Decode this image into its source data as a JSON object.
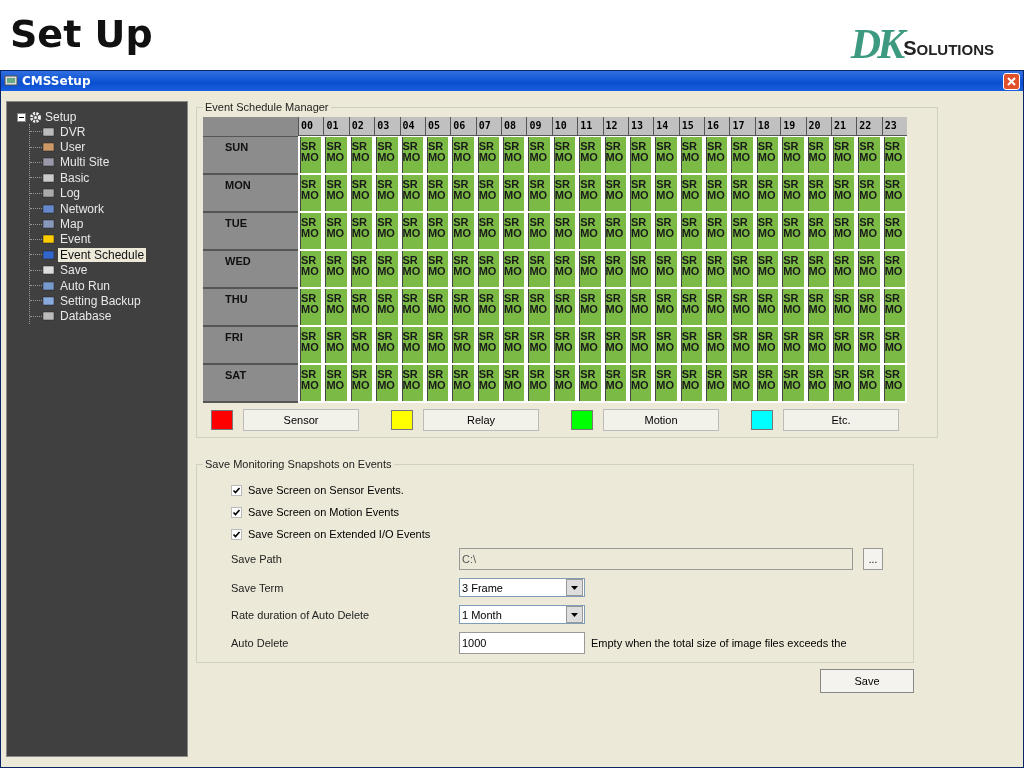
{
  "slide": {
    "title": "Set Up",
    "logo": {
      "mark": "DK",
      "text": "SOLUTIONS"
    }
  },
  "window": {
    "title": "CMSSetup"
  },
  "tree": {
    "label": "Setup",
    "expanded": true,
    "children": [
      {
        "label": "DVR",
        "selected": false
      },
      {
        "label": "User",
        "selected": false
      },
      {
        "label": "Multi Site",
        "selected": false
      },
      {
        "label": "Basic",
        "selected": false
      },
      {
        "label": "Log",
        "selected": false
      },
      {
        "label": "Network",
        "selected": false
      },
      {
        "label": "Map",
        "selected": false
      },
      {
        "label": "Event",
        "selected": false
      },
      {
        "label": "Event Schedule",
        "selected": true
      },
      {
        "label": "Save",
        "selected": false
      },
      {
        "label": "Auto Run",
        "selected": false
      },
      {
        "label": "Setting Backup",
        "selected": false
      },
      {
        "label": "Database",
        "selected": false
      }
    ]
  },
  "schedule": {
    "title": "Event Schedule Manager",
    "hours": [
      "00",
      "01",
      "02",
      "03",
      "04",
      "05",
      "06",
      "07",
      "08",
      "09",
      "10",
      "11",
      "12",
      "13",
      "14",
      "15",
      "16",
      "17",
      "18",
      "19",
      "20",
      "21",
      "22",
      "23"
    ],
    "rows": [
      {
        "day": "SUN",
        "cells": [
          [
            "SR",
            "MO"
          ],
          [
            "SR",
            "MO"
          ],
          [
            "SR",
            "MO"
          ],
          [
            "SR",
            "MO"
          ],
          [
            "SR",
            "MO"
          ],
          [
            "SR",
            "MO"
          ],
          [
            "SR",
            "MO"
          ],
          [
            "SR",
            "MO"
          ],
          [
            "SR",
            "MO"
          ],
          [
            "SR",
            "MO"
          ],
          [
            "SR",
            "MO"
          ],
          [
            "SR",
            "MO"
          ],
          [
            "SR",
            "MO"
          ],
          [
            "SR",
            "MO"
          ],
          [
            "SR",
            "MO"
          ],
          [
            "SR",
            "MO"
          ],
          [
            "SR",
            "MO"
          ],
          [
            "SR",
            "MO"
          ],
          [
            "SR",
            "MO"
          ],
          [
            "SR",
            "MO"
          ],
          [
            "SR",
            "MO"
          ],
          [
            "SR",
            "MO"
          ],
          [
            "SR",
            "MO"
          ],
          [
            "SR",
            "MO"
          ]
        ]
      },
      {
        "day": "MON",
        "cells": [
          [
            "SR",
            "MO"
          ],
          [
            "SR",
            "MO"
          ],
          [
            "SR",
            "MO"
          ],
          [
            "SR",
            "MO"
          ],
          [
            "SR",
            "MO"
          ],
          [
            "SR",
            "MO"
          ],
          [
            "SR",
            "MO"
          ],
          [
            "SR",
            "MO"
          ],
          [
            "SR",
            "MO"
          ],
          [
            "SR",
            "MO"
          ],
          [
            "SR",
            "MO"
          ],
          [
            "SR",
            "MO"
          ],
          [
            "SR",
            "MO"
          ],
          [
            "SR",
            "MO"
          ],
          [
            "SR",
            "MO"
          ],
          [
            "SR",
            "MO"
          ],
          [
            "SR",
            "MO"
          ],
          [
            "SR",
            "MO"
          ],
          [
            "SR",
            "MO"
          ],
          [
            "SR",
            "MO"
          ],
          [
            "SR",
            "MO"
          ],
          [
            "SR",
            "MO"
          ],
          [
            "SR",
            "MO"
          ],
          [
            "SR",
            "MO"
          ]
        ]
      },
      {
        "day": "TUE",
        "cells": [
          [
            "SR",
            "MO"
          ],
          [
            "SR",
            "MO"
          ],
          [
            "SR",
            "MO"
          ],
          [
            "SR",
            "MO"
          ],
          [
            "SR",
            "MO"
          ],
          [
            "SR",
            "MO"
          ],
          [
            "SR",
            "MO"
          ],
          [
            "SR",
            "MO"
          ],
          [
            "SR",
            "MO"
          ],
          [
            "SR",
            "MO"
          ],
          [
            "SR",
            "MO"
          ],
          [
            "SR",
            "MO"
          ],
          [
            "SR",
            "MO"
          ],
          [
            "SR",
            "MO"
          ],
          [
            "SR",
            "MO"
          ],
          [
            "SR",
            "MO"
          ],
          [
            "SR",
            "MO"
          ],
          [
            "SR",
            "MO"
          ],
          [
            "SR",
            "MO"
          ],
          [
            "SR",
            "MO"
          ],
          [
            "SR",
            "MO"
          ],
          [
            "SR",
            "MO"
          ],
          [
            "SR",
            "MO"
          ],
          [
            "SR",
            "MO"
          ]
        ]
      },
      {
        "day": "WED",
        "cells": [
          [
            "SR",
            "MO"
          ],
          [
            "SR",
            "MO"
          ],
          [
            "SR",
            "MO"
          ],
          [
            "SR",
            "MO"
          ],
          [
            "SR",
            "MO"
          ],
          [
            "SR",
            "MO"
          ],
          [
            "SR",
            "MO"
          ],
          [
            "SR",
            "MO"
          ],
          [
            "SR",
            "MO"
          ],
          [
            "SR",
            "MO"
          ],
          [
            "SR",
            "MO"
          ],
          [
            "SR",
            "MO"
          ],
          [
            "SR",
            "MO"
          ],
          [
            "SR",
            "MO"
          ],
          [
            "SR",
            "MO"
          ],
          [
            "SR",
            "MO"
          ],
          [
            "SR",
            "MO"
          ],
          [
            "SR",
            "MO"
          ],
          [
            "SR",
            "MO"
          ],
          [
            "SR",
            "MO"
          ],
          [
            "SR",
            "MO"
          ],
          [
            "SR",
            "MO"
          ],
          [
            "SR",
            "MO"
          ],
          [
            "SR",
            "MO"
          ]
        ]
      },
      {
        "day": "THU",
        "cells": [
          [
            "SR",
            "MO"
          ],
          [
            "SR",
            "MO"
          ],
          [
            "SR",
            "MO"
          ],
          [
            "SR",
            "MO"
          ],
          [
            "SR",
            "MO"
          ],
          [
            "SR",
            "MO"
          ],
          [
            "SR",
            "MO"
          ],
          [
            "SR",
            "MO"
          ],
          [
            "SR",
            "MO"
          ],
          [
            "SR",
            "MO"
          ],
          [
            "SR",
            "MO"
          ],
          [
            "SR",
            "MO"
          ],
          [
            "SR",
            "MO"
          ],
          [
            "SR",
            "MO"
          ],
          [
            "SR",
            "MO"
          ],
          [
            "SR",
            "MO"
          ],
          [
            "SR",
            "MO"
          ],
          [
            "SR",
            "MO"
          ],
          [
            "SR",
            "MO"
          ],
          [
            "SR",
            "MO"
          ],
          [
            "SR",
            "MO"
          ],
          [
            "SR",
            "MO"
          ],
          [
            "SR",
            "MO"
          ],
          [
            "SR",
            "MO"
          ]
        ]
      },
      {
        "day": "FRI",
        "cells": [
          [
            "SR",
            "MO"
          ],
          [
            "SR",
            "MO"
          ],
          [
            "SR",
            "MO"
          ],
          [
            "SR",
            "MO"
          ],
          [
            "SR",
            "MO"
          ],
          [
            "SR",
            "MO"
          ],
          [
            "SR",
            "MO"
          ],
          [
            "SR",
            "MO"
          ],
          [
            "SR",
            "MO"
          ],
          [
            "SR",
            "MO"
          ],
          [
            "SR",
            "MO"
          ],
          [
            "SR",
            "MO"
          ],
          [
            "SR",
            "MO"
          ],
          [
            "SR",
            "MO"
          ],
          [
            "SR",
            "MO"
          ],
          [
            "SR",
            "MO"
          ],
          [
            "SR",
            "MO"
          ],
          [
            "SR",
            "MO"
          ],
          [
            "SR",
            "MO"
          ],
          [
            "SR",
            "MO"
          ],
          [
            "SR",
            "MO"
          ],
          [
            "SR",
            "MO"
          ],
          [
            "SR",
            "MO"
          ],
          [
            "SR",
            "MO"
          ]
        ]
      },
      {
        "day": "SAT",
        "cells": [
          [
            "SR",
            "MO"
          ],
          [
            "SR",
            "MO"
          ],
          [
            "SR",
            "MO"
          ],
          [
            "SR",
            "MO"
          ],
          [
            "SR",
            "MO"
          ],
          [
            "SR",
            "MO"
          ],
          [
            "SR",
            "MO"
          ],
          [
            "SR",
            "MO"
          ],
          [
            "SR",
            "MO"
          ],
          [
            "SR",
            "MO"
          ],
          [
            "SR",
            "MO"
          ],
          [
            "SR",
            "MO"
          ],
          [
            "SR",
            "MO"
          ],
          [
            "SR",
            "MO"
          ],
          [
            "SR",
            "MO"
          ],
          [
            "SR",
            "MO"
          ],
          [
            "SR",
            "MO"
          ],
          [
            "SR",
            "MO"
          ],
          [
            "SR",
            "MO"
          ],
          [
            "SR",
            "MO"
          ],
          [
            "SR",
            "MO"
          ],
          [
            "SR",
            "MO"
          ],
          [
            "SR",
            "MO"
          ],
          [
            "SR",
            "MO"
          ]
        ]
      }
    ],
    "legend": [
      {
        "label": "Sensor",
        "color": "#ff0000"
      },
      {
        "label": "Relay",
        "color": "#ffff00"
      },
      {
        "label": "Motion",
        "color": "#00ff00"
      },
      {
        "label": "Etc.",
        "color": "#00ffff"
      }
    ]
  },
  "snapshots": {
    "title": "Save Monitoring Snapshots on Events",
    "options": [
      {
        "label": "Save Screen on Sensor Events.",
        "checked": true
      },
      {
        "label": "Save Screen on Motion Events",
        "checked": true
      },
      {
        "label": "Save Screen on Extended I/O Events",
        "checked": true
      }
    ],
    "save_path": {
      "label": "Save Path",
      "value": "C:\\",
      "browse": "..."
    },
    "save_term": {
      "label": "Save Term",
      "value": "3 Frame"
    },
    "rate_duration": {
      "label": "Rate duration of Auto Delete",
      "value": "1 Month"
    },
    "auto_delete": {
      "label": "Auto Delete",
      "value": "1000",
      "note": "Empty when the total size of image files exceeds the"
    }
  },
  "save_button": "Save"
}
